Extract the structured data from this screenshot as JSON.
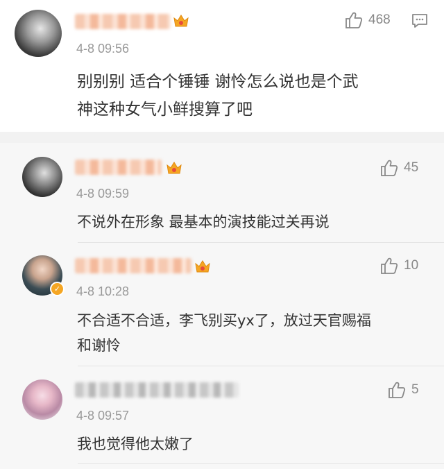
{
  "main_comment": {
    "time": "4-8 09:56",
    "text_line1": "别别别 适合个锤锤 谢怜怎么说也是个武",
    "text_line2": "神这种女气小鲜搜算了吧",
    "likes": "468",
    "icons": [
      "avatar",
      "crown-icon",
      "like-icon",
      "comment-icon"
    ]
  },
  "replies": [
    {
      "time": "4-8 09:59",
      "text_line1": "不说外在形象 最基本的演技能过关再说",
      "text_line2": "",
      "likes": "45"
    },
    {
      "time": "4-8 10:28",
      "text_line1": "不合适不合适，李飞别买yx了，放过天官赐福",
      "text_line2": "和谢怜",
      "likes": "10"
    },
    {
      "time": "4-8 09:57",
      "text_line1": "我也觉得他太嫩了",
      "text_line2": "",
      "likes": "5"
    }
  ],
  "colors": {
    "text": "#333333",
    "meta": "#999999",
    "like": "#888888",
    "reply_bg": "#f7f7f7",
    "crown": "#f5a623",
    "verified_badge": "#f5a623"
  }
}
